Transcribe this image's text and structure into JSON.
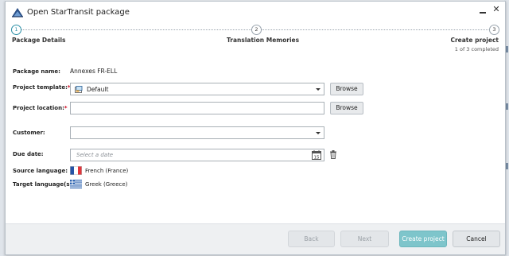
{
  "window": {
    "title": "Open StarTransit package"
  },
  "steps": [
    {
      "number": "1",
      "label": "Package Details",
      "sub": ""
    },
    {
      "number": "2",
      "label": "Translation Memories",
      "sub": ""
    },
    {
      "number": "3",
      "label": "Create project",
      "sub": "1 of 3 completed"
    }
  ],
  "form": {
    "package_name_label": "Package name:",
    "package_name_value": "Annexes FR-ELL",
    "project_template_label": "Project template:",
    "project_template_value": "Default",
    "project_location_label": "Project location:",
    "project_location_value": "",
    "customer_label": "Customer:",
    "customer_value": "",
    "due_date_label": "Due date:",
    "due_date_placeholder": "Select a date",
    "calendar_day": "15",
    "source_language_label": "Source language:",
    "source_language_value": "French (France)",
    "target_language_label": "Target language(s):",
    "target_language_value": "Greek (Greece)",
    "required_mark": "*",
    "browse_label": "Browse"
  },
  "footer": {
    "back_label": "Back",
    "next_label": "Next",
    "create_label": "Create project",
    "cancel_label": "Cancel"
  },
  "colors": {
    "accent": "#2a8fa6",
    "primary_button": "#7ec5cb",
    "required": "#d0021b"
  },
  "icons": {
    "app": "startransit-app-icon",
    "template": "template-icon",
    "calendar": "calendar-icon",
    "trash": "trash-icon",
    "source_flag": "french-flag-icon",
    "target_flag": "greek-flag-icon"
  }
}
